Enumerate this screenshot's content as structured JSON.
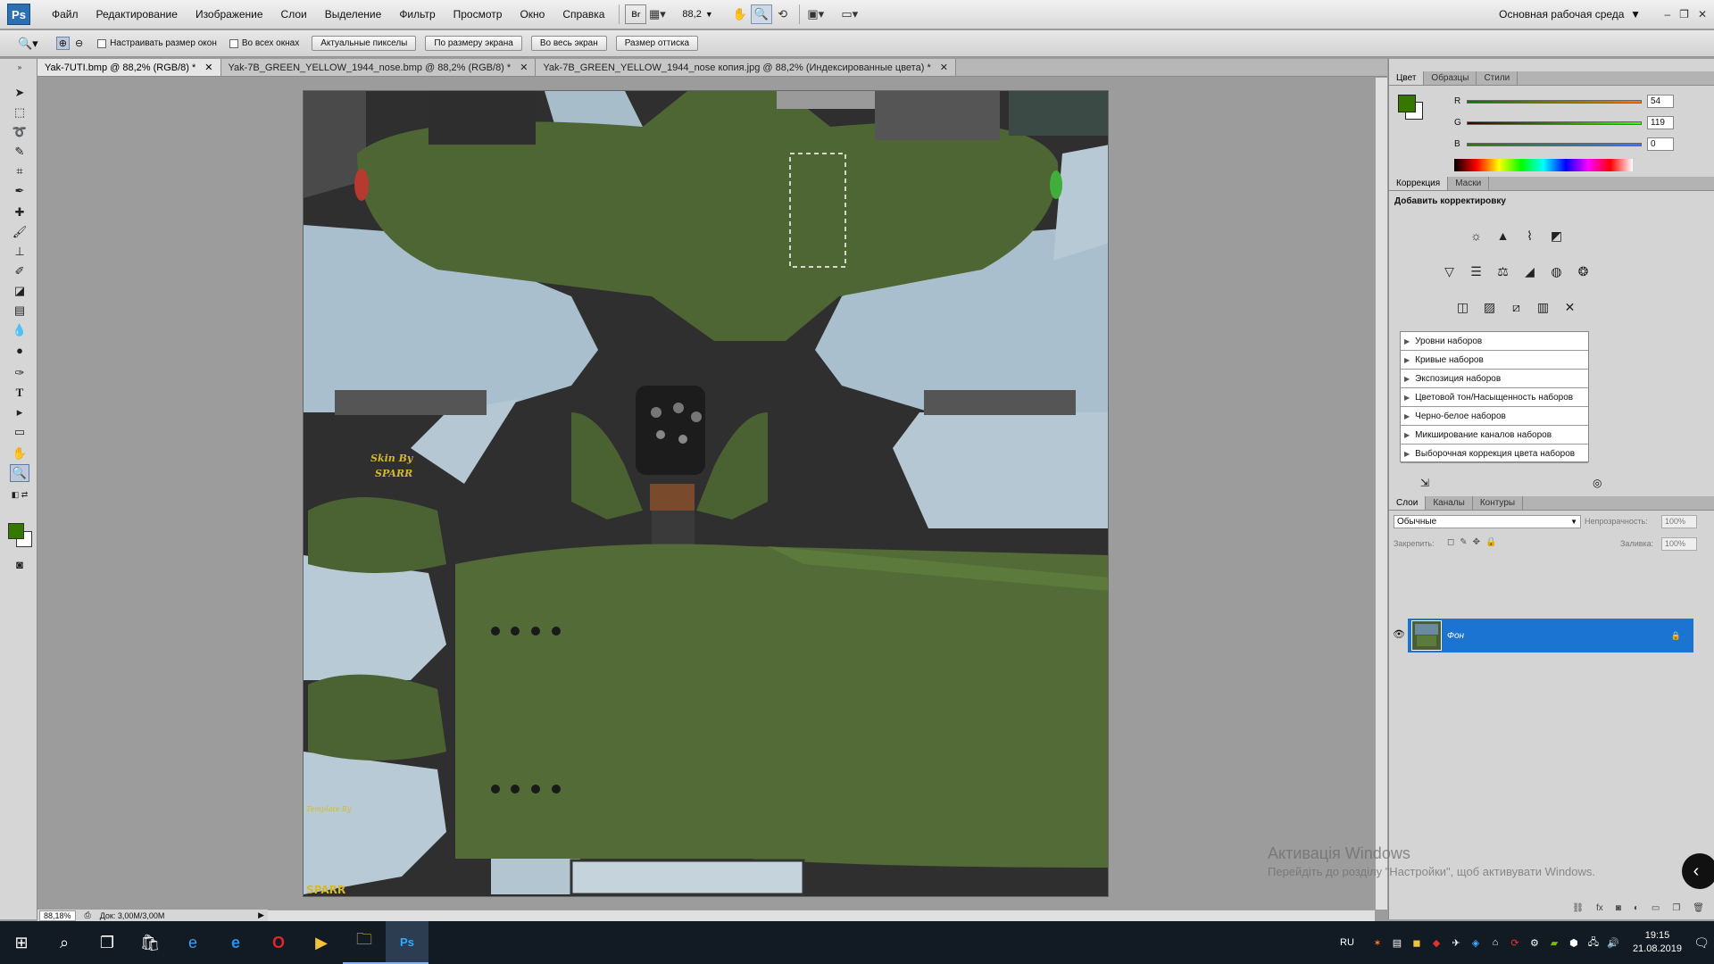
{
  "menubar": {
    "logo": "Ps",
    "items": [
      "Файл",
      "Редактирование",
      "Изображение",
      "Слои",
      "Выделение",
      "Фильтр",
      "Просмотр",
      "Окно",
      "Справка"
    ],
    "zoom_value": "88,2",
    "workspace": "Основная рабочая среда"
  },
  "options": {
    "checks": [
      "Настраивать размер окон",
      "Во всех окнах"
    ],
    "buttons": [
      "Актуальные пикселы",
      "По размеру экрана",
      "Во весь экран",
      "Размер оттиска"
    ]
  },
  "tabs": [
    {
      "label": "Yak-7UTI.bmp @ 88,2% (RGB/8) *",
      "active": true
    },
    {
      "label": "Yak-7B_GREEN_YELLOW_1944_nose.bmp @ 88,2% (RGB/8) *",
      "active": false
    },
    {
      "label": "Yak-7B_GREEN_YELLOW_1944_nose копия.jpg @ 88,2% (Индексированные цвета) *",
      "active": false
    }
  ],
  "status": {
    "zoom": "88,18%",
    "doc": "Док: 3,00M/3,00M"
  },
  "image_texts": {
    "skin_by": "Skin By",
    "sparr": "SPARR",
    "template_by": "Template By",
    "sparr_bottom": "SPARR"
  },
  "color_panel": {
    "tabs": [
      "Цвет",
      "Образцы",
      "Стили"
    ],
    "r_label": "R",
    "g_label": "G",
    "b_label": "B",
    "r": "54",
    "g": "119",
    "b": "0",
    "fg_color": "#367700"
  },
  "adjust_panel": {
    "tabs": [
      "Коррекция",
      "Маски"
    ],
    "title": "Добавить корректировку",
    "presets": [
      "Уровни наборов",
      "Кривые наборов",
      "Экспозиция наборов",
      "Цветовой тон/Насыщенность наборов",
      "Черно-белое наборов",
      "Микширование каналов наборов",
      "Выборочная коррекция цвета наборов"
    ]
  },
  "layers_panel": {
    "tabs": [
      "Слои",
      "Каналы",
      "Контуры"
    ],
    "blend_mode": "Обычные",
    "opacity_label": "Непрозрачность:",
    "opacity": "100%",
    "lock_label": "Закрепить:",
    "fill_label": "Заливка:",
    "fill": "100%",
    "layer_name": "Фон"
  },
  "watermark": {
    "line1": "Активація Windows",
    "line2": "Перейдіть до розділу \"Настройки\", щоб активувати Windows."
  },
  "taskbar": {
    "lang": "RU",
    "time": "19:15",
    "date": "21.08.2019"
  }
}
